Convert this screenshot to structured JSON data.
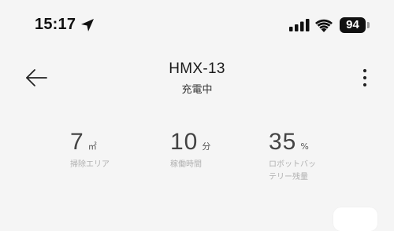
{
  "status_bar": {
    "time": "15:17",
    "battery_level": "94",
    "icons": [
      "location-arrow-icon",
      "cellular-signal-icon",
      "wifi-icon",
      "battery-icon"
    ]
  },
  "header": {
    "back_icon": "arrow-left-icon",
    "title": "HMX-13",
    "subtitle": "充電中",
    "menu_icon": "more-vertical-icon"
  },
  "stats": {
    "area": {
      "value": "7",
      "unit": "㎡",
      "label": "掃除エリア"
    },
    "time": {
      "value": "10",
      "unit": "分",
      "label": "稼働時間"
    },
    "battery": {
      "value": "35",
      "unit": "%",
      "label_line1": "ロボットバッ",
      "label_line2": "テリー残量"
    }
  },
  "colors": {
    "background": "#f5f5f5",
    "value_text": "#444444",
    "label_text": "#b0b0b0"
  }
}
